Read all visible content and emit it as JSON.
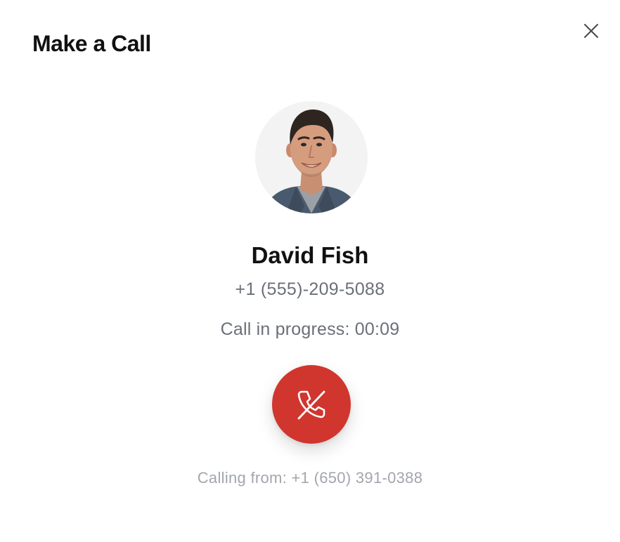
{
  "dialog": {
    "title": "Make a Call",
    "close_icon": "close-icon"
  },
  "contact": {
    "name": "David Fish",
    "phone": "+1 (555)-209-5088",
    "avatar_icon": "avatar-photo"
  },
  "call": {
    "status": "Call in progress: 00:09",
    "hangup_icon": "phone-hangup-icon",
    "hangup_color": "#d0362e",
    "calling_from": "Calling from: +1 (650) 391-0388"
  },
  "colors": {
    "title": "#111111",
    "secondary_text": "#6b6f78",
    "muted_text": "#a2a6ad"
  }
}
